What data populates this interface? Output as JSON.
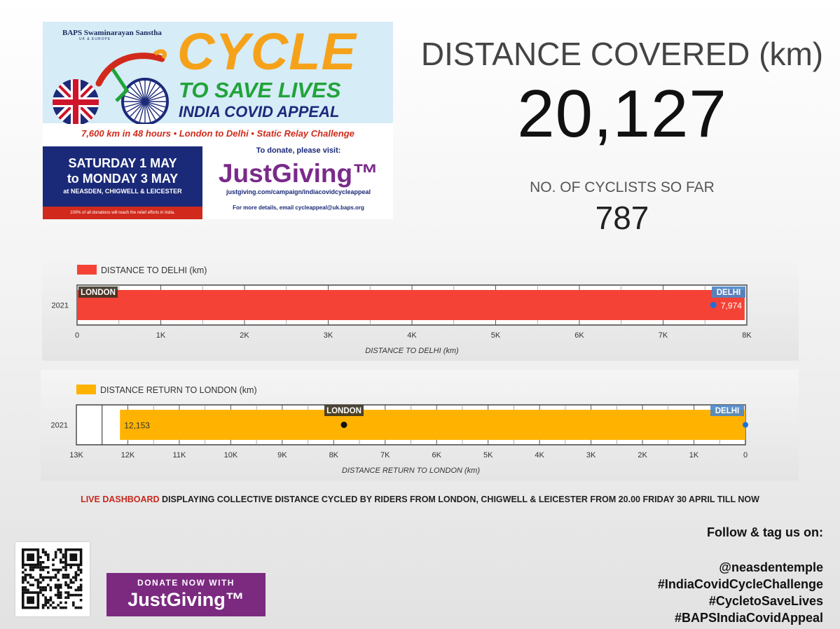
{
  "banner": {
    "org_name": "BAPS Swaminarayan Sanstha",
    "org_sub": "UK & EUROPE",
    "title_cycle": "CYCLE",
    "title_to_save_lives": "TO SAVE LIVES",
    "title_appeal": "INDIA COVID APPEAL",
    "strip": "7,600 km in 48 hours • London to Delhi • Static Relay Challenge",
    "date_line1": "SATURDAY 1 MAY",
    "date_line2": "to MONDAY 3 MAY",
    "date_line3": "at NEASDEN, CHIGWELL & LEICESTER",
    "date_foot": "100% of all donations will reach the relief efforts in India.",
    "donate_prompt": "To donate, please visit:",
    "justgiving": "JustGiving™",
    "url": "justgiving.com/campaign/indiacovidcycleappeal",
    "email_line": "For more details, email cycleappeal@uk.baps.org",
    "colors": {
      "orange": "#f5a21a",
      "green": "#21a33a",
      "navy": "#1b2a78",
      "red": "#d12a1c",
      "purple": "#7a2a8a"
    }
  },
  "stats": {
    "distance_label": "DISTANCE COVERED (km)",
    "distance_value": "20,127",
    "cyclists_label": "NO. OF CYCLISTS SO FAR",
    "cyclists_value": "787"
  },
  "chart_data": [
    {
      "type": "bar",
      "orientation": "horizontal",
      "legend": {
        "label": "DISTANCE TO DELHI (km)",
        "color": "#f44336",
        "position": "top-left"
      },
      "categories": [
        "2021"
      ],
      "series": [
        {
          "name": "DISTANCE TO DELHI (km)",
          "values": [
            7974
          ],
          "data_label": "7,974"
        }
      ],
      "xlabel": "DISTANCE TO DELHI (km)",
      "xlim": [
        0,
        8000
      ],
      "x_reversed": false,
      "ticks": [
        {
          "value": 0,
          "label": "0"
        },
        {
          "value": 1000,
          "label": "1K"
        },
        {
          "value": 2000,
          "label": "2K"
        },
        {
          "value": 3000,
          "label": "3K"
        },
        {
          "value": 4000,
          "label": "4K"
        },
        {
          "value": 5000,
          "label": "5K"
        },
        {
          "value": 6000,
          "label": "6K"
        },
        {
          "value": 7000,
          "label": "7K"
        },
        {
          "value": 8000,
          "label": "8K"
        }
      ],
      "bar_start": 0,
      "annotations": [
        {
          "text": "LONDON",
          "value": 0,
          "color": "#3b3325"
        },
        {
          "text": "DELHI",
          "value": 8000,
          "color": "#4a86c8"
        }
      ],
      "marker": {
        "value": 7600,
        "color": "#1e6fd9"
      }
    },
    {
      "type": "bar",
      "orientation": "horizontal",
      "legend": {
        "label": "DISTANCE RETURN TO LONDON (km)",
        "color": "#ffb300",
        "position": "top-left"
      },
      "categories": [
        "2021"
      ],
      "series": [
        {
          "name": "DISTANCE RETURN TO LONDON (km)",
          "values": [
            12153
          ],
          "data_label": "12,153"
        }
      ],
      "xlabel": "DISTANCE RETURN TO LONDON (km)",
      "xlim": [
        0,
        13000
      ],
      "x_reversed": true,
      "ticks": [
        {
          "value": 13000,
          "label": "13K"
        },
        {
          "value": 12000,
          "label": "12K"
        },
        {
          "value": 11000,
          "label": "11K"
        },
        {
          "value": 10000,
          "label": "10K"
        },
        {
          "value": 9000,
          "label": "9K"
        },
        {
          "value": 8000,
          "label": "8K"
        },
        {
          "value": 7000,
          "label": "7K"
        },
        {
          "value": 6000,
          "label": "6K"
        },
        {
          "value": 5000,
          "label": "5K"
        },
        {
          "value": 4000,
          "label": "4K"
        },
        {
          "value": 3000,
          "label": "3K"
        },
        {
          "value": 2000,
          "label": "2K"
        },
        {
          "value": 1000,
          "label": "1K"
        },
        {
          "value": 0,
          "label": "0"
        }
      ],
      "bar_start": 0,
      "annotations": [
        {
          "text": "LONDON",
          "value": 7800,
          "color": "#3b3325"
        },
        {
          "text": "DELHI",
          "value": 0,
          "color": "#4a86c8"
        }
      ],
      "marker": {
        "value": 7800,
        "color": "#111111"
      },
      "end_marker": {
        "value": 0,
        "color": "#1e6fd9"
      },
      "extra_gridline": 12500
    }
  ],
  "caption": {
    "live": "LIVE DASHBOARD",
    "rest": " DISPLAYING COLLECTIVE DISTANCE CYCLED BY RIDERS FROM LONDON, CHIGWELL & LEICESTER FROM 20.00 FRIDAY 30 APRIL TILL NOW"
  },
  "social": {
    "follow": "Follow & tag us on:",
    "tags": [
      "@neasdentemple",
      "#IndiaCovidCycleChallenge",
      "#CycletoSaveLives",
      "#BAPSIndiaCovidAppeal"
    ]
  },
  "donate_button": {
    "line1": "DONATE NOW WITH",
    "line2": "JustGiving™"
  },
  "icons": {
    "qr": "qr-code-icon"
  }
}
